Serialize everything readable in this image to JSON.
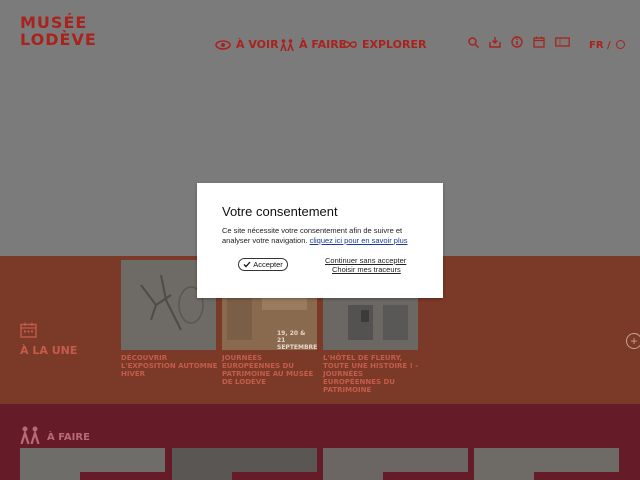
{
  "header": {
    "logo_line1": "MUSÉE",
    "logo_line2": "LODÈVE",
    "nav": [
      {
        "label": "À VOIR",
        "icon": "eye-icon"
      },
      {
        "label": "À FAIRE",
        "icon": "people-icon"
      },
      {
        "label": "EXPLORER",
        "icon": "infinity-icon"
      }
    ],
    "tools": [
      "search-icon",
      "download-icon",
      "info-icon",
      "calendar-icon",
      "ticket-icon"
    ],
    "lang": "FR /"
  },
  "une": {
    "title": "À LA UNE",
    "cards": [
      {
        "caption": "DÉCOUVRIR L'EXPOSITION AUTOMNE HIVER"
      },
      {
        "caption": "JOURNÉES EUROPÉENNES DU PATRIMOINE AU MUSÉE DE LODÈVE",
        "image_text": "19, 20 & 21 SEPTEMBRE"
      },
      {
        "caption": "L'HÔTEL DE FLEURY, TOUTE UNE HISTOIRE ! - JOURNÉES EUROPÉENNES DU PATRIMOINE"
      }
    ],
    "more": "+"
  },
  "afaire": {
    "title": "À FAIRE"
  },
  "consent": {
    "title": "Votre consentement",
    "text": "Ce site nécessite votre consentement afin de suivre et analyser votre navigation.",
    "learn_more": "cliquez ici pour en savoir plus",
    "accept": "Accepter",
    "continue": "Continuer sans accepter",
    "choose": "Choisir mes traceurs"
  },
  "colors": {
    "brand_red": "#a8231e",
    "une_band": "#7b3a27",
    "afaire_band": "#661b29"
  }
}
